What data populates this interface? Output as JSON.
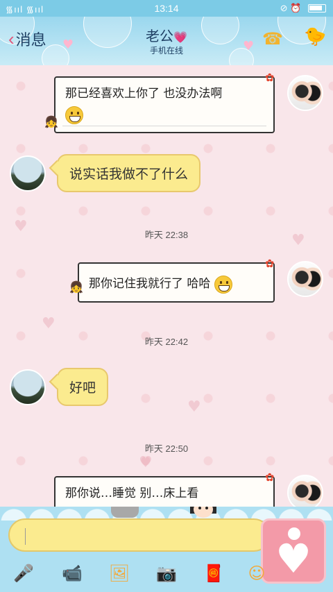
{
  "status_bar": {
    "left_text": "᯾ııl ᯾ııl",
    "time": "13:14",
    "right_icons": "⊘ ⏰"
  },
  "header": {
    "back_label": "消息",
    "contact_name": "老公",
    "status": "手机在线"
  },
  "messages": [
    {
      "side": "right",
      "text": "那已经喜欢上你了 也没办法啊"
    },
    {
      "side": "left",
      "text": "说实话我做不了什么"
    },
    {
      "type": "time",
      "text": "昨天 22:38"
    },
    {
      "side": "right",
      "text": "那你记住我就行了 哈哈"
    },
    {
      "type": "time",
      "text": "昨天 22:42"
    },
    {
      "side": "left",
      "text": "好吧"
    },
    {
      "type": "time",
      "text": "昨天 22:50"
    },
    {
      "side": "right",
      "text": "那你说…睡觉 别…床上看"
    }
  ],
  "input": {
    "placeholder": ""
  },
  "colors": {
    "accent": "#7ccbe6",
    "bubble_left": "#fbeb8f",
    "background": "#f9e6ea"
  }
}
